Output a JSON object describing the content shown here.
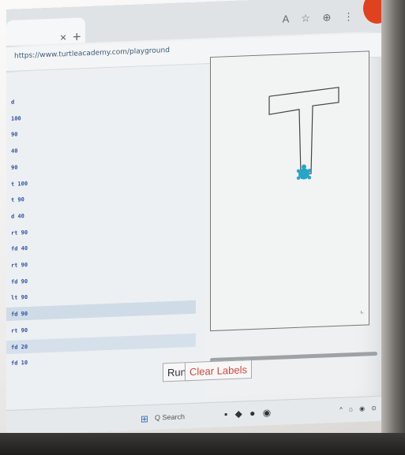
{
  "browser": {
    "tab_close": "×",
    "new_tab": "+",
    "toolbar_icons": "A ☆ ⊕ ⋮",
    "url": "https://www.turtleacademy.com/playground"
  },
  "editor": {
    "lines": [
      "d",
      "100",
      "90",
      "40",
      "90",
      "100",
      "90",
      "40",
      "90",
      "40",
      "90",
      "90",
      "90",
      "90",
      "90",
      "20",
      "10"
    ],
    "prefixes": [
      "",
      "",
      "",
      "",
      "",
      "t",
      "t",
      "d",
      "rt",
      "fd",
      "rt",
      "fd",
      "lt",
      "fd",
      "rt",
      "fd",
      "fd"
    ]
  },
  "canvas": {
    "resize_glyph": "⌞"
  },
  "buttons": {
    "run": "Run",
    "clear": "Clear Labels"
  },
  "taskbar": {
    "start_icon": "⊞",
    "search": "Q Search",
    "apps": "▪ ◆ ● ◉",
    "tray": "^ ⌂ ◉ ⊙"
  },
  "colors": {
    "profile": "#e0421f",
    "clear_text": "#d0493e",
    "code": "#2a52a8",
    "turtle": "#26a5c9"
  }
}
